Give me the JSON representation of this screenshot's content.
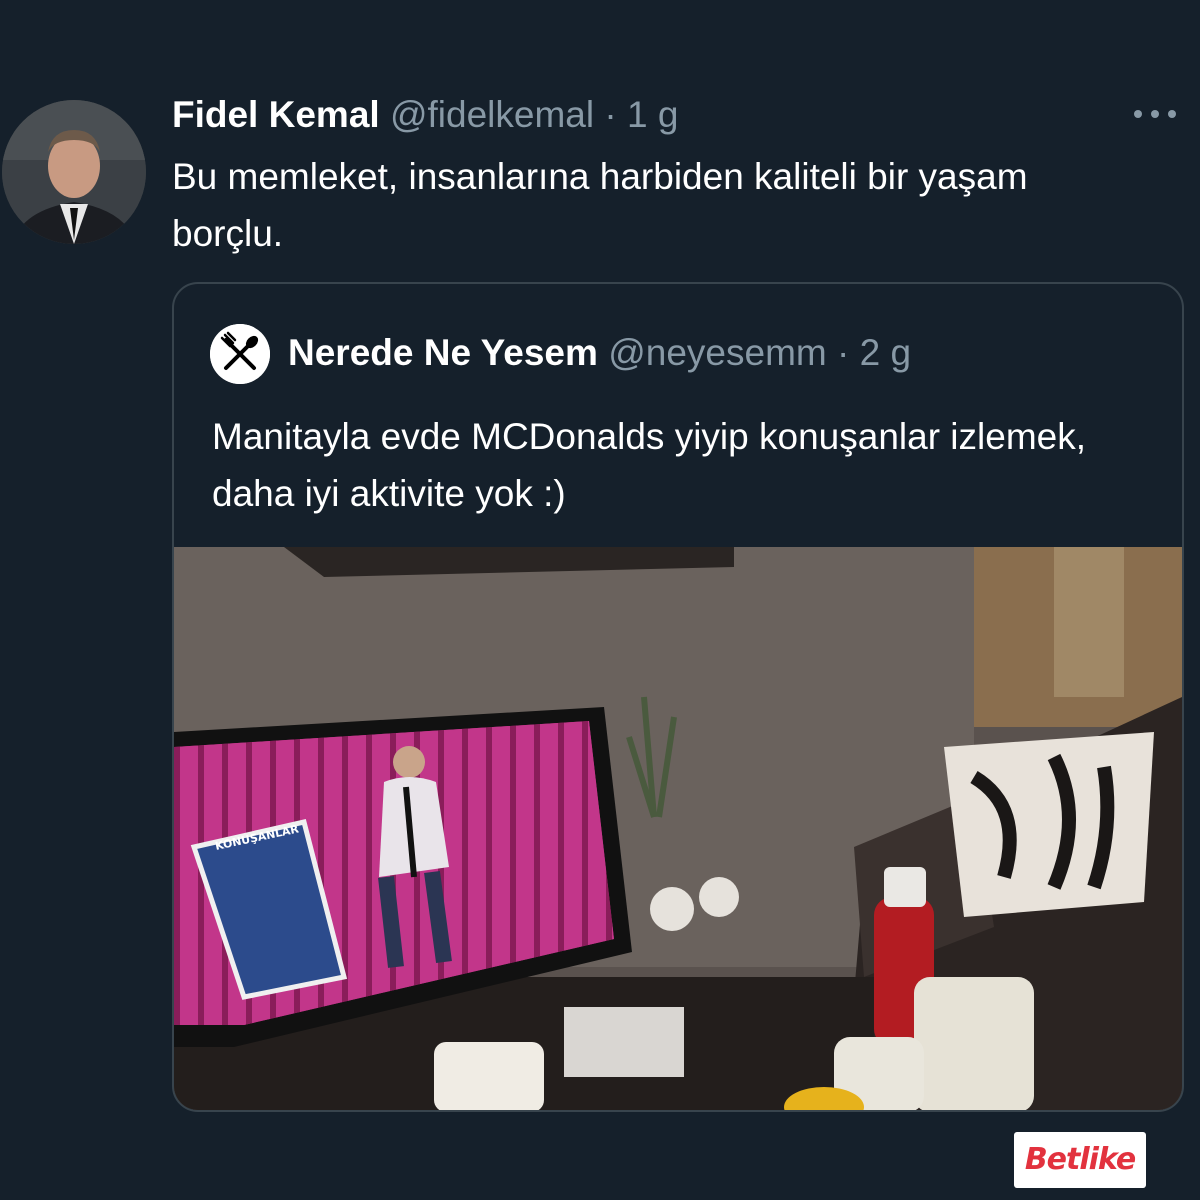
{
  "tweet": {
    "author_name": "Fidel Kemal",
    "author_handle": "@fidelkemal",
    "separator": "·",
    "time": "1 g",
    "more_icon": "more-horizontal-icon",
    "text": "Bu memleket, insanlarına harbiden kaliteli bir yaşam borçlu."
  },
  "quoted_tweet": {
    "author_name": "Nerede Ne Yesem",
    "author_handle": "@neyesemm",
    "separator": "·",
    "time": "2 g",
    "avatar_icon": "fork-spoon-icon",
    "text": "Manitayla evde MCDonalds yiyip konuşanlar izlemek, daha iyi aktivite yok :)",
    "media_sign_text": "KONUŞANLAR"
  },
  "watermark": {
    "brand": "Betlike",
    "brand_color": "#e2323e"
  },
  "colors": {
    "background": "#15202b",
    "muted_text": "#8899a6",
    "border": "#38444d"
  }
}
